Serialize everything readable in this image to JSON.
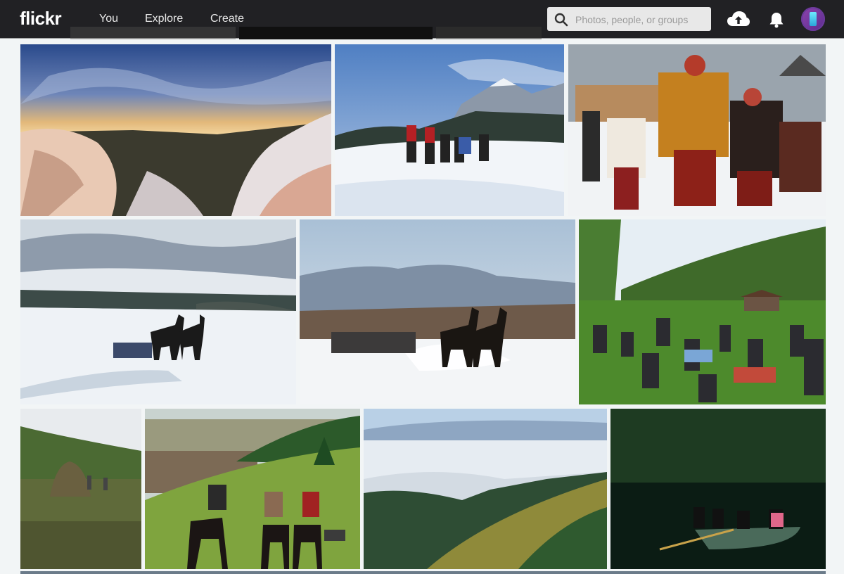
{
  "header": {
    "logo": "flickr",
    "nav": [
      {
        "label": "You"
      },
      {
        "label": "Explore"
      },
      {
        "label": "Create"
      }
    ],
    "search": {
      "placeholder": "Photos, people, or groups",
      "value": ""
    },
    "icons": [
      "upload-cloud-icon",
      "notifications-bell-icon",
      "user-avatar"
    ]
  },
  "gallery": {
    "rows": [
      {
        "photos": [
          "sunrise-over-snowy-mountains",
          "hikers-in-snow",
          "costumed-winter-parade"
        ]
      },
      {
        "photos": [
          "horse-sleigh-snowy-valley",
          "horse-sleigh-kicking-snow",
          "crowd-picnic-meadow"
        ]
      },
      {
        "photos": [
          "haystack-on-hill",
          "riders-on-green-hill",
          "hills-above-clouds",
          "rowboat-on-lake"
        ]
      }
    ]
  },
  "colors": {
    "header_bg": "#212124",
    "page_bg": "#f2f5f6",
    "search_bg": "#e8e8e8",
    "avatar": "#8e44ad"
  }
}
